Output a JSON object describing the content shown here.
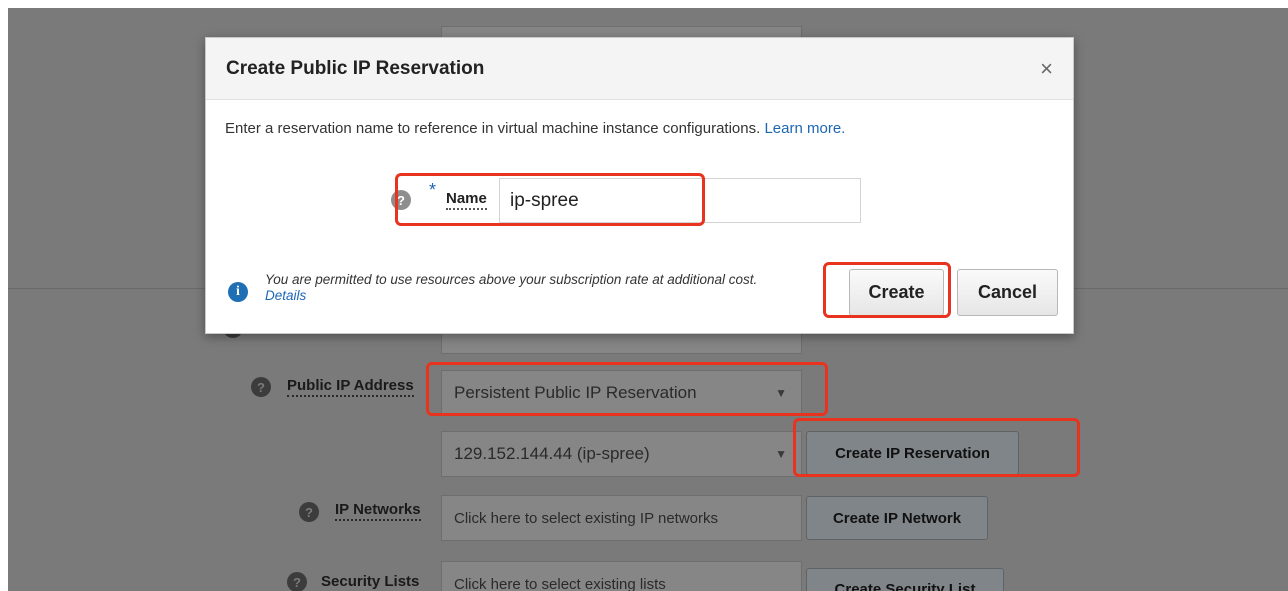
{
  "dialog": {
    "title": "Create Public IP Reservation",
    "close_icon": "×",
    "description": "Enter a reservation name to reference in virtual machine instance configurations.",
    "learn_more": "Learn more.",
    "name_label": "Name",
    "required_marker": "*",
    "name_value": "ip-spree",
    "info_text": "You are permitted to use resources above your subscription rate at additional cost.",
    "details_link": "Details",
    "create_label": "Create",
    "cancel_label": "Cancel"
  },
  "form": {
    "public_ip_label": "Public IP Address",
    "public_ip_type": "Persistent Public IP Reservation",
    "ip_reservation_value": "129.152.144.44 (ip-spree)",
    "create_ip_reservation": "Create IP Reservation",
    "ip_networks_label": "IP Networks",
    "ip_networks_placeholder": "Click here to select existing IP networks",
    "create_ip_network": "Create IP Network",
    "security_lists_label": "Security Lists",
    "security_lists_placeholder": "Click here to select existing lists",
    "create_security_list": "Create Security List"
  },
  "icons": {
    "help": "?",
    "info": "i",
    "dropdown": "▼"
  },
  "colors": {
    "overlay": "#7a7a7a",
    "highlight": "#e8331f",
    "link": "#1e66b4",
    "info_icon": "#1f6fb5"
  }
}
